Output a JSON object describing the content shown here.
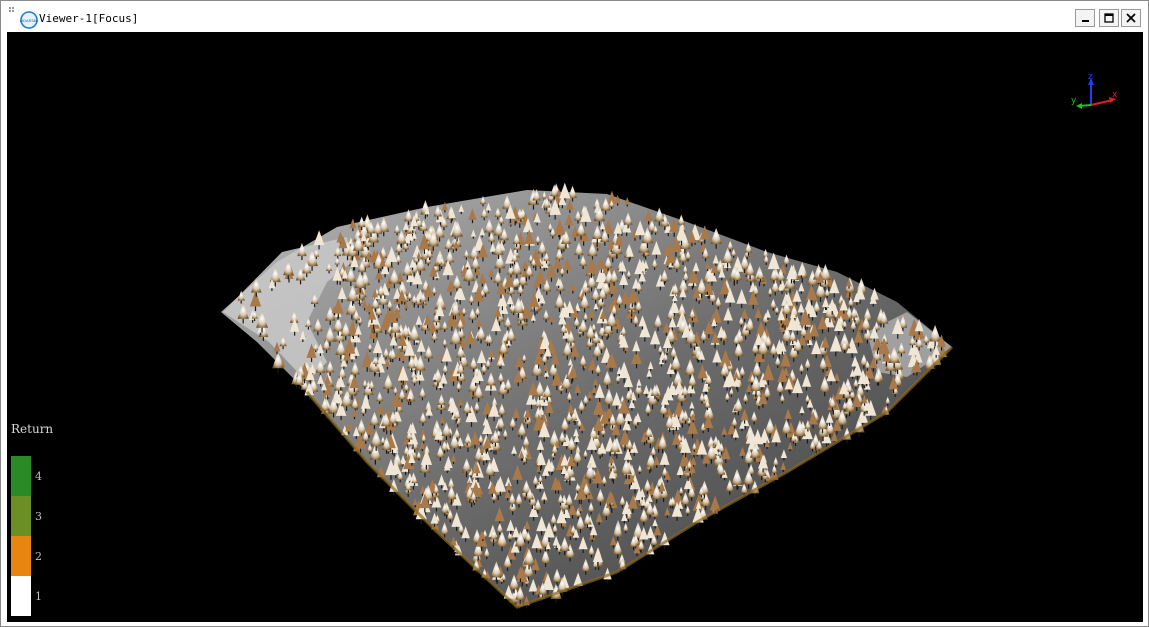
{
  "window": {
    "title": "Viewer-1[Focus]",
    "logo_text": "LIDAR360",
    "controls": {
      "minimize": "minimize-icon",
      "maximize": "maximize-icon",
      "close": "close-icon"
    }
  },
  "viewport": {
    "background": "#000000",
    "content": "point-cloud-forest"
  },
  "axis_gizmo": {
    "x_label": "x",
    "y_label": "y",
    "z_label": "z",
    "colors": {
      "x": "#e02020",
      "y": "#20c020",
      "z": "#2040ff"
    }
  },
  "legend": {
    "title": "Return",
    "items": [
      {
        "label": "4",
        "color": "#2a8a25"
      },
      {
        "label": "3",
        "color": "#6b8f25"
      },
      {
        "label": "2",
        "color": "#e88410"
      },
      {
        "label": "1",
        "color": "#ffffff"
      }
    ]
  }
}
